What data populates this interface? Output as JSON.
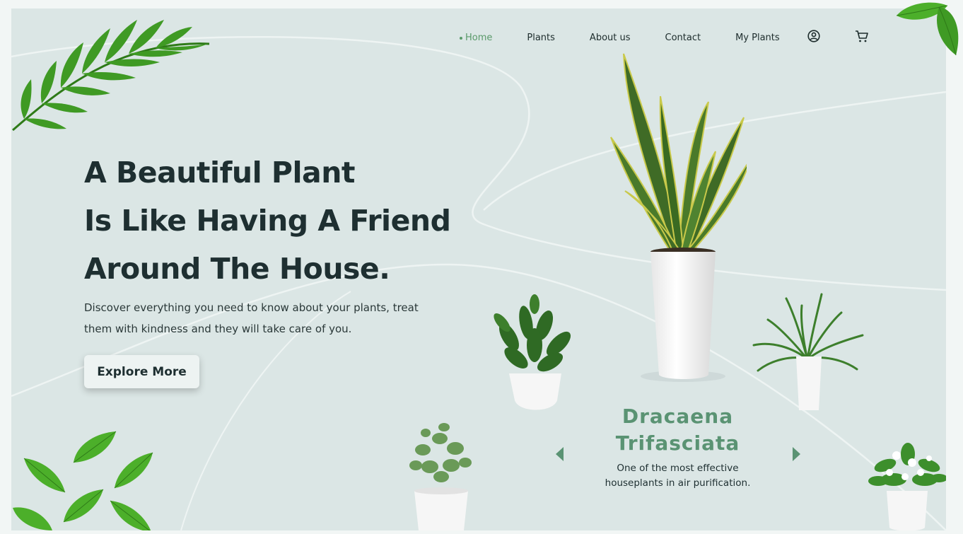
{
  "nav": {
    "items": [
      {
        "label": "Home",
        "active": true
      },
      {
        "label": "Plants"
      },
      {
        "label": "About us"
      },
      {
        "label": "Contact"
      },
      {
        "label": "My Plants"
      }
    ],
    "icons": [
      "user-icon",
      "cart-icon"
    ]
  },
  "hero": {
    "title_lines": [
      "A Beautiful Plant",
      "Is Like Having A Friend",
      "Around The House."
    ],
    "description_lines": [
      "Discover everything you need to know about your plants, treat",
      "them with kindness and they will take care of you."
    ],
    "cta_label": "Explore More"
  },
  "featured": {
    "name_lines": [
      "Dracaena",
      "Trifasciata"
    ],
    "description_lines": [
      "One of the most effective",
      "houseplants in air purification."
    ],
    "prev_icon": "triangle-left-icon",
    "next_icon": "triangle-right-icon"
  },
  "colors": {
    "background": "#dbe6e5",
    "accent": "#5a9373",
    "text_dark": "#1e2f31",
    "leaf": "#3f9a24"
  }
}
